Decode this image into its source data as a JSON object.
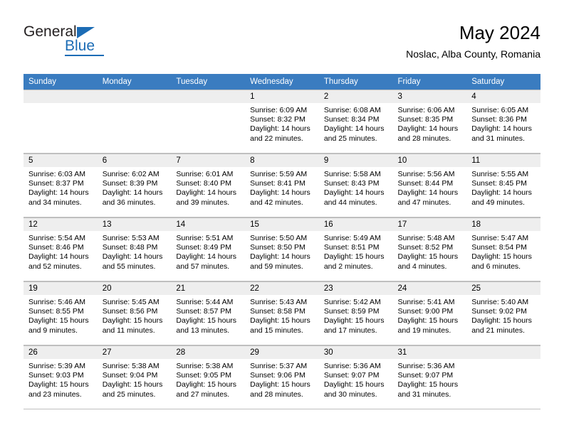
{
  "logo": {
    "word_one": "General",
    "word_two": "Blue",
    "triangle_color": "#1c6cb5",
    "text_color": "#231f20"
  },
  "header": {
    "month_title": "May 2024",
    "location": "Noslac, Alba County, Romania",
    "header_bg": "#3a7cc0",
    "header_text": "#ffffff"
  },
  "weekdays": [
    "Sunday",
    "Monday",
    "Tuesday",
    "Wednesday",
    "Thursday",
    "Friday",
    "Saturday"
  ],
  "labels": {
    "sunrise_prefix": "Sunrise:",
    "sunset_prefix": "Sunset:",
    "daylight_prefix": "Daylight:"
  },
  "weeks": [
    [
      {
        "day": "",
        "line1": "",
        "line2": "",
        "line3": "",
        "line4": ""
      },
      {
        "day": "",
        "line1": "",
        "line2": "",
        "line3": "",
        "line4": ""
      },
      {
        "day": "",
        "line1": "",
        "line2": "",
        "line3": "",
        "line4": ""
      },
      {
        "day": "1",
        "line1": "Sunrise: 6:09 AM",
        "line2": "Sunset: 8:32 PM",
        "line3": "Daylight: 14 hours",
        "line4": "and 22 minutes."
      },
      {
        "day": "2",
        "line1": "Sunrise: 6:08 AM",
        "line2": "Sunset: 8:34 PM",
        "line3": "Daylight: 14 hours",
        "line4": "and 25 minutes."
      },
      {
        "day": "3",
        "line1": "Sunrise: 6:06 AM",
        "line2": "Sunset: 8:35 PM",
        "line3": "Daylight: 14 hours",
        "line4": "and 28 minutes."
      },
      {
        "day": "4",
        "line1": "Sunrise: 6:05 AM",
        "line2": "Sunset: 8:36 PM",
        "line3": "Daylight: 14 hours",
        "line4": "and 31 minutes."
      }
    ],
    [
      {
        "day": "5",
        "line1": "Sunrise: 6:03 AM",
        "line2": "Sunset: 8:37 PM",
        "line3": "Daylight: 14 hours",
        "line4": "and 34 minutes."
      },
      {
        "day": "6",
        "line1": "Sunrise: 6:02 AM",
        "line2": "Sunset: 8:39 PM",
        "line3": "Daylight: 14 hours",
        "line4": "and 36 minutes."
      },
      {
        "day": "7",
        "line1": "Sunrise: 6:01 AM",
        "line2": "Sunset: 8:40 PM",
        "line3": "Daylight: 14 hours",
        "line4": "and 39 minutes."
      },
      {
        "day": "8",
        "line1": "Sunrise: 5:59 AM",
        "line2": "Sunset: 8:41 PM",
        "line3": "Daylight: 14 hours",
        "line4": "and 42 minutes."
      },
      {
        "day": "9",
        "line1": "Sunrise: 5:58 AM",
        "line2": "Sunset: 8:43 PM",
        "line3": "Daylight: 14 hours",
        "line4": "and 44 minutes."
      },
      {
        "day": "10",
        "line1": "Sunrise: 5:56 AM",
        "line2": "Sunset: 8:44 PM",
        "line3": "Daylight: 14 hours",
        "line4": "and 47 minutes."
      },
      {
        "day": "11",
        "line1": "Sunrise: 5:55 AM",
        "line2": "Sunset: 8:45 PM",
        "line3": "Daylight: 14 hours",
        "line4": "and 49 minutes."
      }
    ],
    [
      {
        "day": "12",
        "line1": "Sunrise: 5:54 AM",
        "line2": "Sunset: 8:46 PM",
        "line3": "Daylight: 14 hours",
        "line4": "and 52 minutes."
      },
      {
        "day": "13",
        "line1": "Sunrise: 5:53 AM",
        "line2": "Sunset: 8:48 PM",
        "line3": "Daylight: 14 hours",
        "line4": "and 55 minutes."
      },
      {
        "day": "14",
        "line1": "Sunrise: 5:51 AM",
        "line2": "Sunset: 8:49 PM",
        "line3": "Daylight: 14 hours",
        "line4": "and 57 minutes."
      },
      {
        "day": "15",
        "line1": "Sunrise: 5:50 AM",
        "line2": "Sunset: 8:50 PM",
        "line3": "Daylight: 14 hours",
        "line4": "and 59 minutes."
      },
      {
        "day": "16",
        "line1": "Sunrise: 5:49 AM",
        "line2": "Sunset: 8:51 PM",
        "line3": "Daylight: 15 hours",
        "line4": "and 2 minutes."
      },
      {
        "day": "17",
        "line1": "Sunrise: 5:48 AM",
        "line2": "Sunset: 8:52 PM",
        "line3": "Daylight: 15 hours",
        "line4": "and 4 minutes."
      },
      {
        "day": "18",
        "line1": "Sunrise: 5:47 AM",
        "line2": "Sunset: 8:54 PM",
        "line3": "Daylight: 15 hours",
        "line4": "and 6 minutes."
      }
    ],
    [
      {
        "day": "19",
        "line1": "Sunrise: 5:46 AM",
        "line2": "Sunset: 8:55 PM",
        "line3": "Daylight: 15 hours",
        "line4": "and 9 minutes."
      },
      {
        "day": "20",
        "line1": "Sunrise: 5:45 AM",
        "line2": "Sunset: 8:56 PM",
        "line3": "Daylight: 15 hours",
        "line4": "and 11 minutes."
      },
      {
        "day": "21",
        "line1": "Sunrise: 5:44 AM",
        "line2": "Sunset: 8:57 PM",
        "line3": "Daylight: 15 hours",
        "line4": "and 13 minutes."
      },
      {
        "day": "22",
        "line1": "Sunrise: 5:43 AM",
        "line2": "Sunset: 8:58 PM",
        "line3": "Daylight: 15 hours",
        "line4": "and 15 minutes."
      },
      {
        "day": "23",
        "line1": "Sunrise: 5:42 AM",
        "line2": "Sunset: 8:59 PM",
        "line3": "Daylight: 15 hours",
        "line4": "and 17 minutes."
      },
      {
        "day": "24",
        "line1": "Sunrise: 5:41 AM",
        "line2": "Sunset: 9:00 PM",
        "line3": "Daylight: 15 hours",
        "line4": "and 19 minutes."
      },
      {
        "day": "25",
        "line1": "Sunrise: 5:40 AM",
        "line2": "Sunset: 9:02 PM",
        "line3": "Daylight: 15 hours",
        "line4": "and 21 minutes."
      }
    ],
    [
      {
        "day": "26",
        "line1": "Sunrise: 5:39 AM",
        "line2": "Sunset: 9:03 PM",
        "line3": "Daylight: 15 hours",
        "line4": "and 23 minutes."
      },
      {
        "day": "27",
        "line1": "Sunrise: 5:38 AM",
        "line2": "Sunset: 9:04 PM",
        "line3": "Daylight: 15 hours",
        "line4": "and 25 minutes."
      },
      {
        "day": "28",
        "line1": "Sunrise: 5:38 AM",
        "line2": "Sunset: 9:05 PM",
        "line3": "Daylight: 15 hours",
        "line4": "and 27 minutes."
      },
      {
        "day": "29",
        "line1": "Sunrise: 5:37 AM",
        "line2": "Sunset: 9:06 PM",
        "line3": "Daylight: 15 hours",
        "line4": "and 28 minutes."
      },
      {
        "day": "30",
        "line1": "Sunrise: 5:36 AM",
        "line2": "Sunset: 9:07 PM",
        "line3": "Daylight: 15 hours",
        "line4": "and 30 minutes."
      },
      {
        "day": "31",
        "line1": "Sunrise: 5:36 AM",
        "line2": "Sunset: 9:07 PM",
        "line3": "Daylight: 15 hours",
        "line4": "and 31 minutes."
      },
      {
        "day": "",
        "line1": "",
        "line2": "",
        "line3": "",
        "line4": ""
      }
    ]
  ]
}
